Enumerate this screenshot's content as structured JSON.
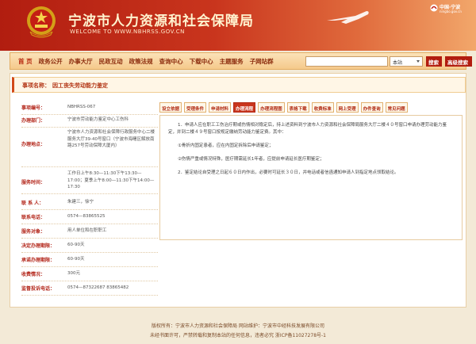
{
  "header": {
    "site_title": "宁波市人力资源和社会保障局",
    "site_url": "WELCOME TO WWW.NBHRSS.GOV.CN",
    "city_logo_name": "中国·宁波",
    "city_logo_sub": "ningbo.gov.cn"
  },
  "nav": {
    "items": [
      "首 页",
      "政务公开",
      "办事大厅",
      "民政互动",
      "政策法规",
      "查询中心",
      "下载中心",
      "主题服务",
      "子网站群"
    ],
    "search_select": "本站",
    "search_button": "搜索",
    "advanced_button": "高级搜索"
  },
  "breadcrumb": {
    "label": "事项名称：",
    "value": "因工丧失劳动能力鉴定"
  },
  "info": {
    "rows": [
      {
        "key": "事项编号：",
        "value": "NBHRSS-067"
      },
      {
        "key": "办理部门：",
        "value": "宁波市劳动能力鉴定中心工伤科"
      },
      {
        "key": "办理地点：",
        "value": "宁波市人力资源和社会保障行政服务中心二楼服务大厅39-40号窗口（宁波市海曙区解放南路257号劳动保障大厦内）"
      },
      {
        "key": "服务时间：",
        "value": "工作日上午8:30—11:30下午13:30—17:00；夏季上午8:00—11:30下午14:00—17:30"
      },
      {
        "key": "联 系 人：",
        "value": "朱建三，徐宁"
      },
      {
        "key": "联系电话：",
        "value": "0574—83865525"
      },
      {
        "key": "服务对象：",
        "value": "用人单位和在职职工"
      },
      {
        "key": "决定办理期限：",
        "value": "60-90天"
      },
      {
        "key": "承诺办理期限：",
        "value": "60-90天"
      },
      {
        "key": "收费情况：",
        "value": "300元"
      },
      {
        "key": "监督投诉电话：",
        "value": "0574—87322687 83865482"
      }
    ]
  },
  "tabs": [
    "设立依据",
    "受理条件",
    "申请材料",
    "办理流程",
    "办理流程图",
    "表格下载",
    "收费标准",
    "网上受理",
    "办件查询",
    "常见问题"
  ],
  "active_tab_index": 3,
  "content": {
    "paragraphs": [
      "1．申请人应在职工工伤治疗期或伤情相对稳定后，持上述资料到宁波市人力资源和社会保障局服务大厅二楼４０号窗口申请办理劳动能力鉴定，并到二楼４９号窗口按规定缴纳劳动能力鉴定费。其中：",
      "①骨折内固定患者，应在内固定拆除后申请鉴定；",
      "②伤情严重或情况特殊，医疗期需延长1年者，应提前申请延长医疗期鉴定；",
      "2．鉴定结论自受理之日起６０日内作出，必要时可延长３０日，并电话或者信函通知申请人到指定地点领取结论。"
    ]
  },
  "footer": {
    "line1": "版权所有：宁波市人力资源和社会保障局  网站维护：宁波市中经科技发展有限公司",
    "line2": "未经书面许可，严禁转载和复制本站的任何信息，违者必究  浙ICP备11027278号-1"
  },
  "colors": {
    "brand_red": "#b11d10",
    "nav_bg": "#f5c98b",
    "label_red": "#b3261a"
  }
}
